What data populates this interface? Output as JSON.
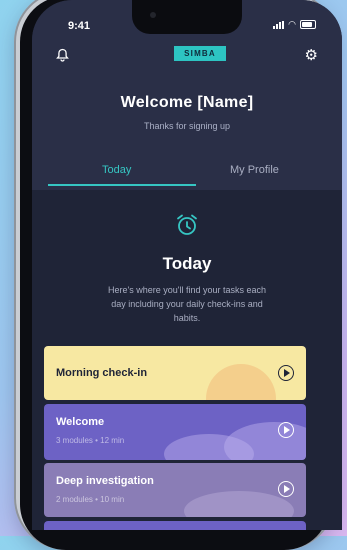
{
  "status_bar": {
    "time": "9:41"
  },
  "header": {
    "brand": "SIMBA",
    "title": "Welcome [Name]",
    "subtitle": "Thanks for signing up"
  },
  "tabs": [
    {
      "label": "Today",
      "active": true
    },
    {
      "label": "My Profile",
      "active": false
    }
  ],
  "today": {
    "title": "Today",
    "description": "Here's where you'll find your tasks each day including your daily check-ins and habits."
  },
  "cards": [
    {
      "title": "Morning check-in",
      "meta": ""
    },
    {
      "title": "Welcome",
      "meta": "3 modules • 12 min"
    },
    {
      "title": "Deep investigation",
      "meta": "2 modules • 10 min"
    }
  ],
  "colors": {
    "accent": "#36c6c3",
    "background": "#1f2437",
    "header_background": "#2a2f47",
    "card_checkin": "#f7e8a2",
    "card_welcome": "#6d62c5",
    "card_investigation": "#8a7db6"
  },
  "icons": {
    "top_left": "bell-icon",
    "top_right": "gear-icon",
    "section": "alarm-clock-icon",
    "card_action": "play-icon"
  }
}
